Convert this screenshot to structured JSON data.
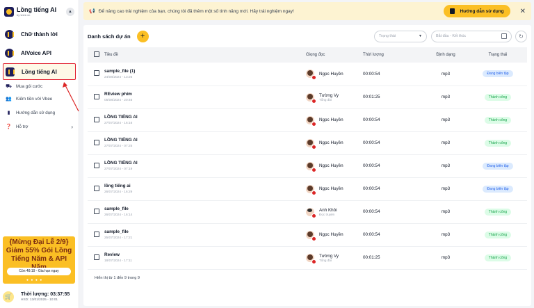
{
  "brand": {
    "name": "Lồng tiếng AI",
    "sub": "by vbee.vn"
  },
  "products": [
    {
      "label": "Chữ thành lời"
    },
    {
      "label": "AIVoice API"
    },
    {
      "label": "Lồng tiếng AI"
    }
  ],
  "menu": [
    {
      "label": "Mua gói cước",
      "icon": "cart-icon"
    },
    {
      "label": "Kiếm tiền với Vbee",
      "icon": "people-icon"
    },
    {
      "label": "Hướng dẫn sử dụng",
      "icon": "book-icon"
    },
    {
      "label": "Hỗ trợ",
      "icon": "help-icon"
    }
  ],
  "promo": {
    "title": "{Mừng Đại Lễ 2/9} Giảm 55% Gói Lồng Tiếng Năm & API Năm",
    "button": "Còn 48:19 - Gia hạn ngay"
  },
  "quota": {
    "label": "Thời lượng: 03:37:55",
    "expiry": "HSD: 13/01/2025 - 10:01"
  },
  "notice": {
    "text": "Để nâng cao trải nghiệm của bạn, chúng tôi đã thêm một số tính năng mới. Hãy trải nghiệm ngay!",
    "button": "Hướng dẫn sử dụng"
  },
  "list": {
    "title": "Danh sách dự án",
    "status_placeholder": "Trạng thái",
    "date_placeholder": "Bắt đầu - Kết thúc",
    "columns": [
      "Tiêu đề",
      "Giọng đọc",
      "Thời lượng",
      "Định dạng",
      "Trạng thái"
    ],
    "rows": [
      {
        "title": "sample_file (1)",
        "date": "24/08/2024 - 13:26",
        "voice": "Ngọc Huyền",
        "voice_sub": "",
        "duration": "00:00:54",
        "format": "mp3",
        "status": "Đang biên tập",
        "status_color": "#2563eb"
      },
      {
        "title": "REview phim",
        "date": "05/08/2024 - 20:46",
        "voice": "Tường Vy",
        "voice_sub": "Tổng đài",
        "duration": "00:01:25",
        "format": "mp3",
        "status": "Thành công",
        "status_color": "#16a34a"
      },
      {
        "title": "LỒNG TIẾNG AI",
        "date": "27/07/2024 - 16:16",
        "voice": "Ngọc Huyền",
        "voice_sub": "",
        "duration": "00:00:54",
        "format": "mp3",
        "status": "Thành công",
        "status_color": "#16a34a"
      },
      {
        "title": "LỒNG TIẾNG AI",
        "date": "27/07/2024 - 07:25",
        "voice": "Ngọc Huyền",
        "voice_sub": "",
        "duration": "00:00:54",
        "format": "mp3",
        "status": "Thành công",
        "status_color": "#16a34a"
      },
      {
        "title": "LỒNG TIẾNG AI",
        "date": "27/07/2024 - 07:19",
        "voice": "Ngọc Huyền",
        "voice_sub": "",
        "duration": "00:00:54",
        "format": "mp3",
        "status": "Đang biên tập",
        "status_color": "#2563eb"
      },
      {
        "title": "lồng tiếng ai",
        "date": "26/07/2024 - 16:29",
        "voice": "Ngọc Huyền",
        "voice_sub": "",
        "duration": "00:00:54",
        "format": "mp3",
        "status": "Đang biên tập",
        "status_color": "#2563eb"
      },
      {
        "title": "sample_file",
        "date": "26/07/2024 - 16:14",
        "voice": "Anh Khôi",
        "voice_sub": "Đọc truyện",
        "duration": "00:00:54",
        "format": "mp3",
        "status": "Thành công",
        "status_color": "#16a34a"
      },
      {
        "title": "sample_file",
        "date": "25/07/2024 - 17:21",
        "voice": "Ngọc Huyền",
        "voice_sub": "",
        "duration": "00:00:54",
        "format": "mp3",
        "status": "Thành công",
        "status_color": "#16a34a"
      },
      {
        "title": "Review",
        "date": "18/07/2024 - 17:11",
        "voice": "Tường Vy",
        "voice_sub": "Tổng đài",
        "duration": "00:01:25",
        "format": "mp3",
        "status": "Thành công",
        "status_color": "#16a34a"
      }
    ],
    "footer": "Hiển thị từ 1 đến 9 trong 9"
  }
}
